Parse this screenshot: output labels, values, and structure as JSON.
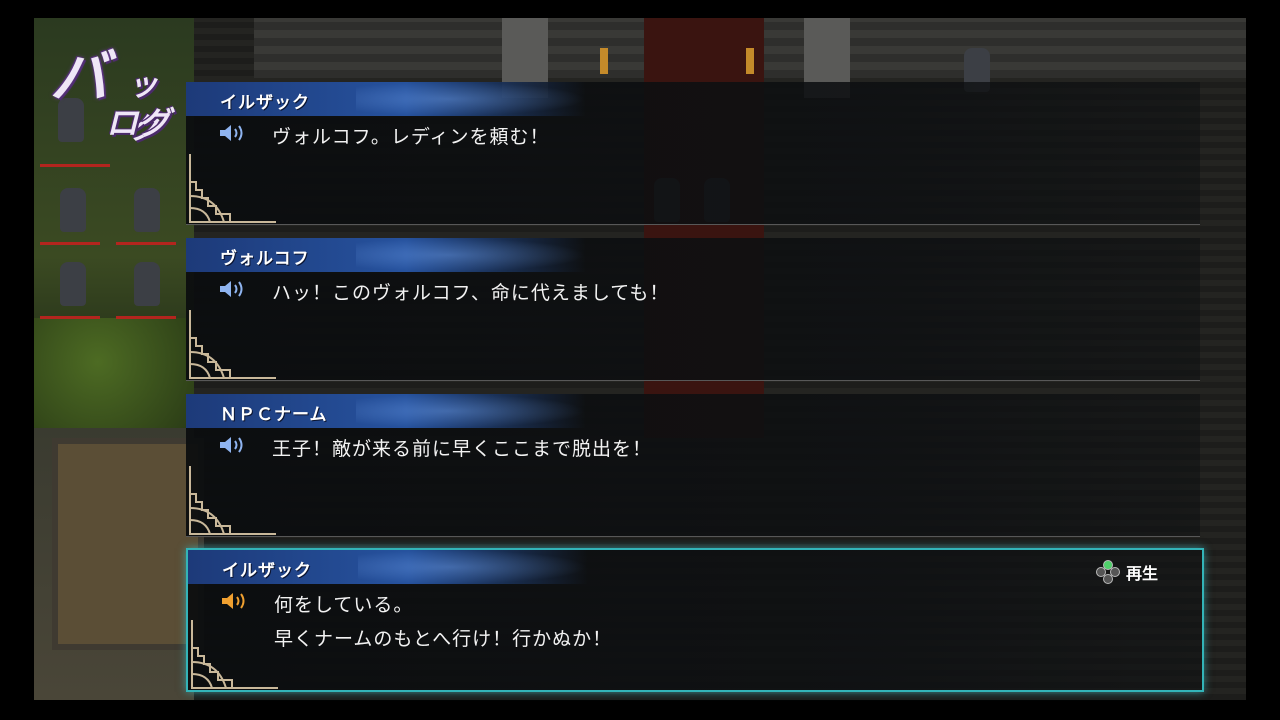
{
  "screen": {
    "title_part1": "バ",
    "title_part2": "ック",
    "title_part3": "ログ"
  },
  "entries": [
    {
      "speaker": "イルザック",
      "lines": [
        "ヴォルコフ。レディンを頼む！"
      ],
      "voice_icon": "speaker-blue",
      "active": false
    },
    {
      "speaker": "ヴォルコフ",
      "lines": [
        "ハッ！このヴォルコフ、命に代えましても！"
      ],
      "voice_icon": "speaker-blue",
      "active": false
    },
    {
      "speaker": "ＮＰＣナーム",
      "lines": [
        "王子！敵が来る前に早くここまで脱出を！"
      ],
      "voice_icon": "speaker-blue",
      "active": false
    },
    {
      "speaker": "イルザック",
      "lines": [
        "何をしている。",
        "早くナームのもとへ行け！行かぬか！"
      ],
      "voice_icon": "speaker-orange",
      "active": true,
      "action_label": "再生",
      "action_icon": "dpad-icon"
    }
  ],
  "colors": {
    "name_bar": "#26529e",
    "active_border": "#33b4b8",
    "speaker_blue": "#8fb4f0",
    "speaker_orange": "#f0a030",
    "title_outline": "#4b2a6b"
  }
}
